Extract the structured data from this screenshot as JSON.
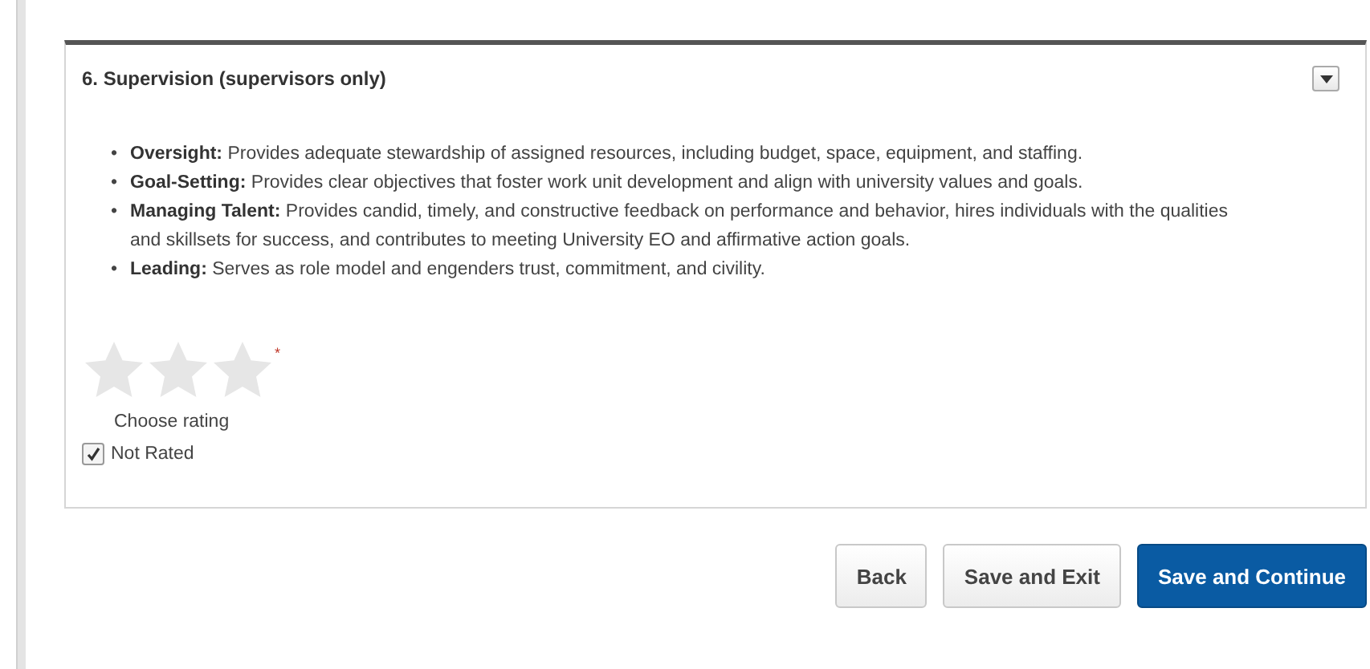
{
  "section": {
    "title": "6. Supervision (supervisors only)",
    "bullets": [
      {
        "marker": "•",
        "text": "**Oversight:** Provides adequate stewardship of assigned resources, including budget, space, equipment, and staffing."
      },
      {
        "marker": "•",
        "text": "**Goal-Setting:** Provides clear objectives that foster work unit development and align with university values and goals."
      },
      {
        "marker": "•",
        "text": "**Managing Talent:** Provides candid, timely, and constructive feedback on performance and behavior, hires individuals with the qualities and skillsets for success, and contributes to meeting University EO and affirmative action goals."
      },
      {
        "marker": "•",
        "text": "**Leading:** Serves as role model and engenders trust, commitment, and civility."
      }
    ],
    "rating": {
      "stars": 0,
      "required_mark": "*",
      "caption": "Choose rating"
    },
    "not_rated": {
      "label": "Not Rated",
      "checked": true
    }
  },
  "buttons": [
    {
      "label": "Back",
      "kind": "default"
    },
    {
      "label": "Save and Exit",
      "kind": "default"
    },
    {
      "label": "Save and Continue",
      "kind": "primary"
    }
  ]
}
